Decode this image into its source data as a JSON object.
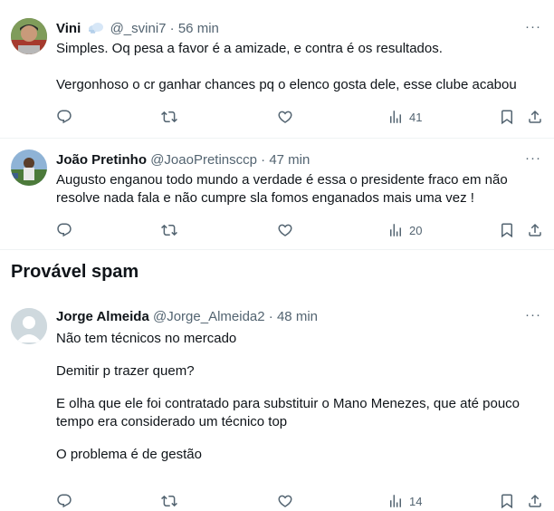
{
  "tweets": [
    {
      "name": "Vini",
      "handle": "@_svini7",
      "time": "56 min",
      "paragraphs": [
        "Simples. Oq pesa a favor é a amizade, e contra é os resultados.",
        "Vergonhoso o cr ganhar chances pq o elenco gosta dele, esse clube acabou"
      ],
      "views": "41",
      "avatar_icon": "user-photo-avatar",
      "badge_icon": "cloud-emoji-icon"
    },
    {
      "name": "João Pretinho",
      "handle": "@JoaoPretinsccp",
      "time": "47 min",
      "paragraphs": [
        "Augusto enganou todo mundo a verdade é essa o presidente fraco em não resolve nada fala e não cumpre sla fomos enganados mais uma vez !"
      ],
      "views": "20",
      "avatar_icon": "user-photo-avatar"
    }
  ],
  "spam_section": {
    "title": "Provável spam",
    "tweet": {
      "name": "Jorge Almeida",
      "handle": "@Jorge_Almeida2",
      "time": "48 min",
      "paragraphs": [
        "Não tem técnicos no mercado",
        "Demitir p trazer quem?",
        "E olha que ele foi contratado para substituir o Mano Menezes, que até pouco tempo era considerado um técnico top",
        "O problema é de gestão"
      ],
      "views": "14",
      "avatar_icon": "default-avatar-icon"
    }
  },
  "separator": "·",
  "more_label": "···",
  "colors": {
    "text": "#0f1419",
    "secondary": "#536471",
    "divider": "#eff3f4",
    "default_avatar_bg": "#cfd9de"
  }
}
